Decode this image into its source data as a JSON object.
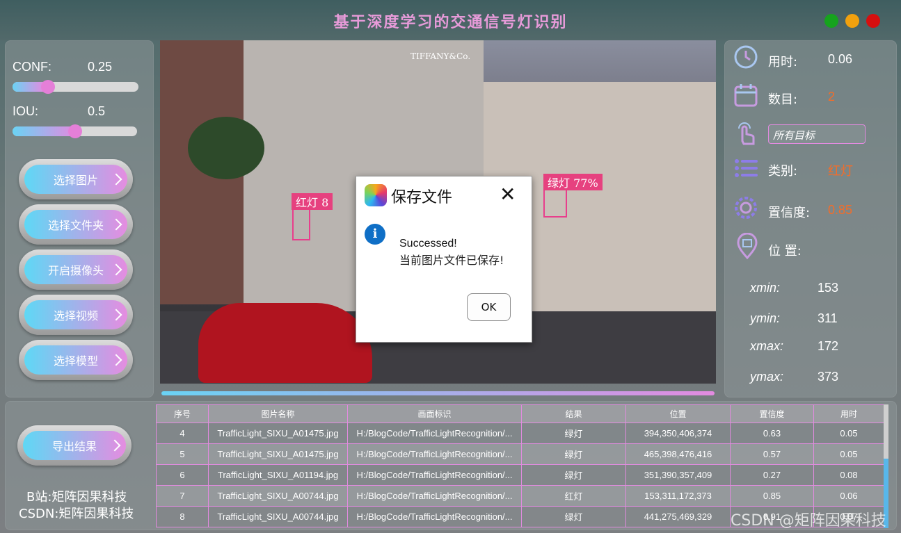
{
  "window": {
    "title": "基于深度学习的交通信号灯识别",
    "controls": {
      "green": "#16a31d",
      "orange": "#f1a10e",
      "red": "#d60f0f"
    }
  },
  "left_panel": {
    "conf": {
      "label": "CONF:",
      "value": "0.25",
      "level": 0.25
    },
    "iou": {
      "label": "IOU:",
      "value": "0.5",
      "level": 0.5
    },
    "buttons": [
      "选择图片",
      "选择文件夹",
      "开启摄像头",
      "选择视频",
      "选择模型"
    ]
  },
  "viewer": {
    "detections": [
      {
        "label": "红灯 8"
      },
      {
        "label": "绿灯 77%"
      }
    ],
    "scene_sign": "TIFFANY&Co."
  },
  "dialog": {
    "title": "保存文件",
    "close": "✕",
    "info_icon": "i",
    "message_line1": "Successed!",
    "message_line2": "当前图片文件已保存!",
    "ok_label": "OK"
  },
  "right_panel": {
    "time": {
      "label": "用时:",
      "value": "0.06",
      "icon": "clock-icon"
    },
    "count": {
      "label": "数目:",
      "value": "2",
      "icon": "calendar-icon"
    },
    "target": {
      "value": "所有目标",
      "icon": "touch-icon"
    },
    "class": {
      "label": "类别:",
      "value": "红灯",
      "icon": "list-icon"
    },
    "confidence": {
      "label": "置信度:",
      "value": "0.85",
      "icon": "gear-icon"
    },
    "position": {
      "label": "位 置:",
      "icon": "location-icon"
    },
    "coords": [
      {
        "label": "xmin:",
        "value": "153"
      },
      {
        "label": "ymin:",
        "value": "311"
      },
      {
        "label": "xmax:",
        "value": "172"
      },
      {
        "label": "ymax:",
        "value": "373"
      }
    ]
  },
  "bottom_panel": {
    "export_label": "导出结果",
    "brand_line1": "B站:矩阵因果科技",
    "brand_line2": "CSDN:矩阵因果科技",
    "watermark": "CSDN @矩阵因果科技"
  },
  "table": {
    "headers": [
      "序号",
      "图片名称",
      "画面标识",
      "结果",
      "位置",
      "置信度",
      "用时"
    ],
    "rows": [
      [
        "4",
        "TrafficLight_SIXU_A01475.jpg",
        "H:/BlogCode/TrafficLightRecognition/...",
        "绿灯",
        "394,350,406,374",
        "0.63",
        "0.05"
      ],
      [
        "5",
        "TrafficLight_SIXU_A01475.jpg",
        "H:/BlogCode/TrafficLightRecognition/...",
        "绿灯",
        "465,398,476,416",
        "0.57",
        "0.05"
      ],
      [
        "6",
        "TrafficLight_SIXU_A01194.jpg",
        "H:/BlogCode/TrafficLightRecognition/...",
        "绿灯",
        "351,390,357,409",
        "0.27",
        "0.08"
      ],
      [
        "7",
        "TrafficLight_SIXU_A00744.jpg",
        "H:/BlogCode/TrafficLightRecognition/...",
        "红灯",
        "153,311,172,373",
        "0.85",
        "0.06"
      ],
      [
        "8",
        "TrafficLight_SIXU_A00744.jpg",
        "H:/BlogCode/TrafficLightRecognition/...",
        "绿灯",
        "441,275,469,329",
        "0.91",
        "0.07"
      ]
    ]
  }
}
